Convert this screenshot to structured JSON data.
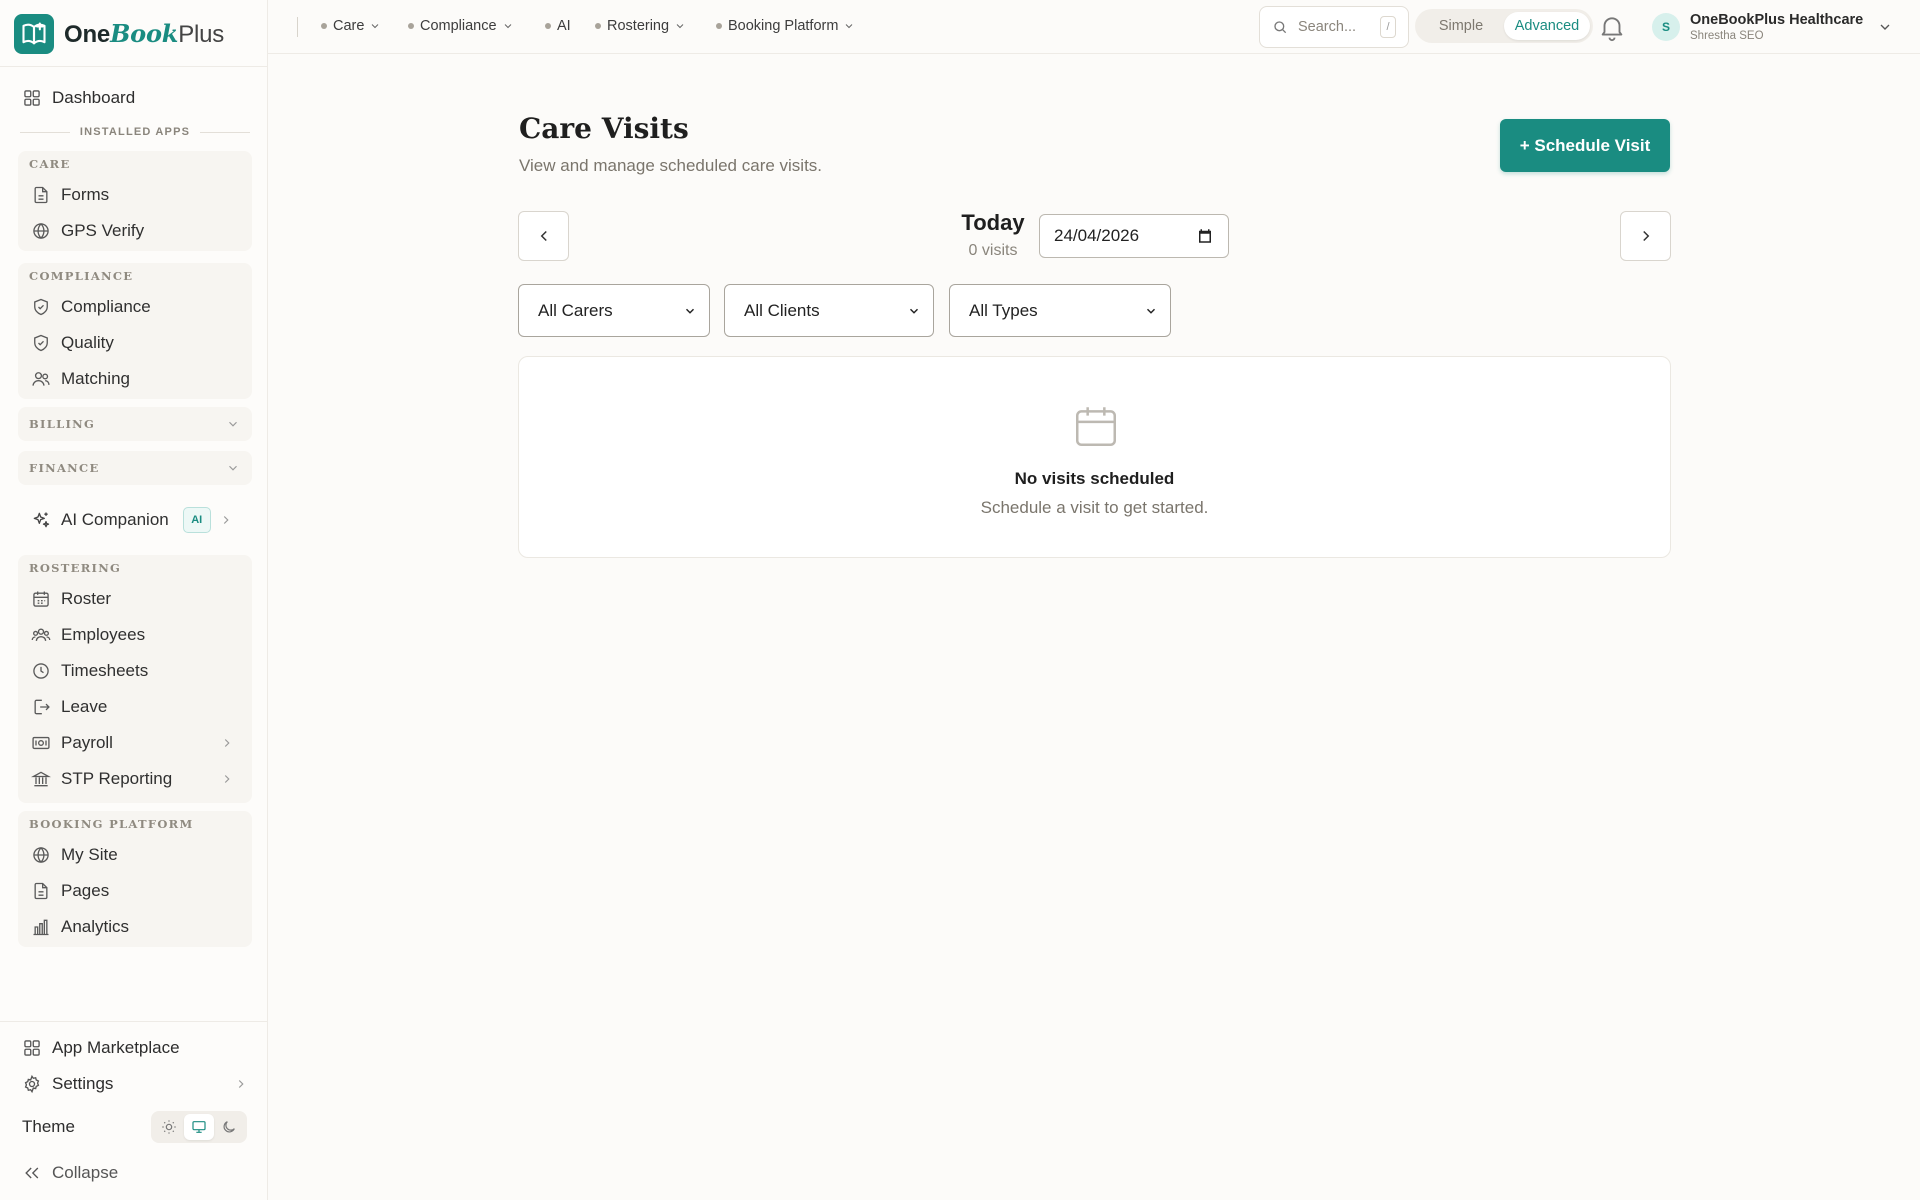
{
  "brand": {
    "one": "One",
    "book": "Book",
    "plus": "Plus",
    "accent": "#1a8c81"
  },
  "sidebar": {
    "dashboard": "Dashboard",
    "installed_apps": "INSTALLED APPS",
    "care": {
      "heading": "CARE",
      "items": [
        "Forms",
        "GPS Verify"
      ]
    },
    "compliance": {
      "heading": "COMPLIANCE",
      "items": [
        "Compliance",
        "Quality",
        "Matching"
      ]
    },
    "billing": "BILLING",
    "finance": "FINANCE",
    "ai_companion": {
      "label": "AI Companion",
      "badge": "AI"
    },
    "rostering": {
      "heading": "ROSTERING",
      "items": [
        "Roster",
        "Employees",
        "Timesheets",
        "Leave",
        "Payroll",
        "STP Reporting"
      ]
    },
    "booking": {
      "heading": "BOOKING PLATFORM",
      "items": [
        "My Site",
        "Pages",
        "Analytics"
      ]
    },
    "app_marketplace": "App Marketplace",
    "settings": "Settings",
    "theme": "Theme",
    "theme_active": "system",
    "collapse": "Collapse"
  },
  "topnav": {
    "items": [
      "Care",
      "Compliance",
      "AI",
      "Rostering",
      "Booking Platform"
    ],
    "search_placeholder": "Search...",
    "search_kbd": "/",
    "mode_simple": "Simple",
    "mode_advanced": "Advanced",
    "mode_active": "Advanced",
    "user_initial": "S",
    "user_name": "OneBookPlus Healthcare",
    "user_role": "Shrestha SEO"
  },
  "main": {
    "title": "Care Visits",
    "subtitle": "View and manage scheduled care visits.",
    "schedule_button": "+ Schedule Visit",
    "today_label": "Today",
    "visit_count": "0 visits",
    "date_value": "24/04/2026",
    "filters": {
      "carers": "All Carers",
      "clients": "All Clients",
      "types": "All Types"
    },
    "empty_title": "No visits scheduled",
    "empty_subtitle": "Schedule a visit to get started."
  }
}
